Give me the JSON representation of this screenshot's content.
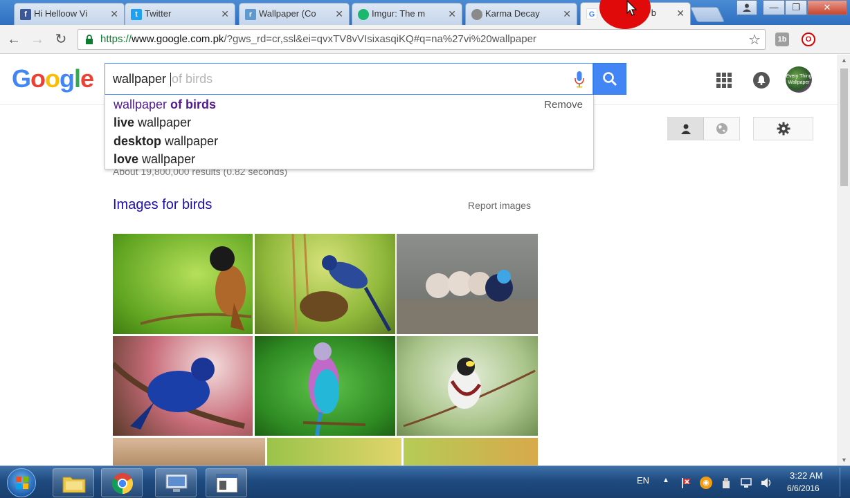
{
  "browser": {
    "tabs": [
      {
        "title": "Hi Helloow Vi",
        "icon": "facebook-icon",
        "color": "#3b5998"
      },
      {
        "title": "Twitter",
        "icon": "twitter-icon",
        "color": "#1da1f2"
      },
      {
        "title": "Wallpaper (Co",
        "icon": "reddit-icon",
        "color": "#5f99cf"
      },
      {
        "title": "Imgur: The m",
        "icon": "imgur-icon",
        "color": "#1bb76e"
      },
      {
        "title": "Karma Decay",
        "icon": "karma-decay-icon",
        "color": "#8a8a8a"
      },
      {
        "title": "wallpaper of b",
        "icon": "google-icon",
        "color": "#4285f4"
      }
    ],
    "close_glyph": "✕",
    "window_controls": {
      "minimize": "—",
      "maximize": "❐",
      "close": "✕"
    },
    "address_bar": {
      "scheme": "https://",
      "host": "www.google.com.pk",
      "path": "/?gws_rd=cr,ssl&ei=qvxTV8vVIsixasqiKQ#q=na%27vi%20wallpaper"
    },
    "nav": {
      "back": "←",
      "forward": "→",
      "reload": "↻",
      "star": "☆"
    },
    "extensions": [
      {
        "label": "1b",
        "color": "#9e9e9e"
      },
      {
        "label": "O",
        "color": "#d50000"
      }
    ]
  },
  "google": {
    "logo": [
      {
        "ch": "G",
        "color": "#4285f4"
      },
      {
        "ch": "o",
        "color": "#ea4335"
      },
      {
        "ch": "o",
        "color": "#fbbc05"
      },
      {
        "ch": "g",
        "color": "#4285f4"
      },
      {
        "ch": "l",
        "color": "#34a853"
      },
      {
        "ch": "e",
        "color": "#ea4335"
      }
    ],
    "search": {
      "typed": "wallpaper ",
      "ghost": "of birds"
    },
    "suggestions": [
      {
        "normal": "wallpaper ",
        "bold": "of birds",
        "bold_first": false
      },
      {
        "bold": "live",
        "normal": " wallpaper",
        "bold_first": true
      },
      {
        "bold": "desktop",
        "normal": " wallpaper",
        "bold_first": true
      },
      {
        "bold": "love",
        "normal": " wallpaper",
        "bold_first": true
      }
    ],
    "remove_label": "Remove",
    "results_count": "About 19,800,000 results (0.82 seconds)",
    "images_heading": "Images for birds",
    "report_images": "Report images",
    "avatar_text": "Every Thing Wallpaper"
  },
  "taskbar": {
    "apps": [
      "file-explorer",
      "chrome",
      "remote-desktop",
      "app-window"
    ],
    "language": "EN",
    "time": "3:22 AM",
    "date": "6/6/2016"
  }
}
